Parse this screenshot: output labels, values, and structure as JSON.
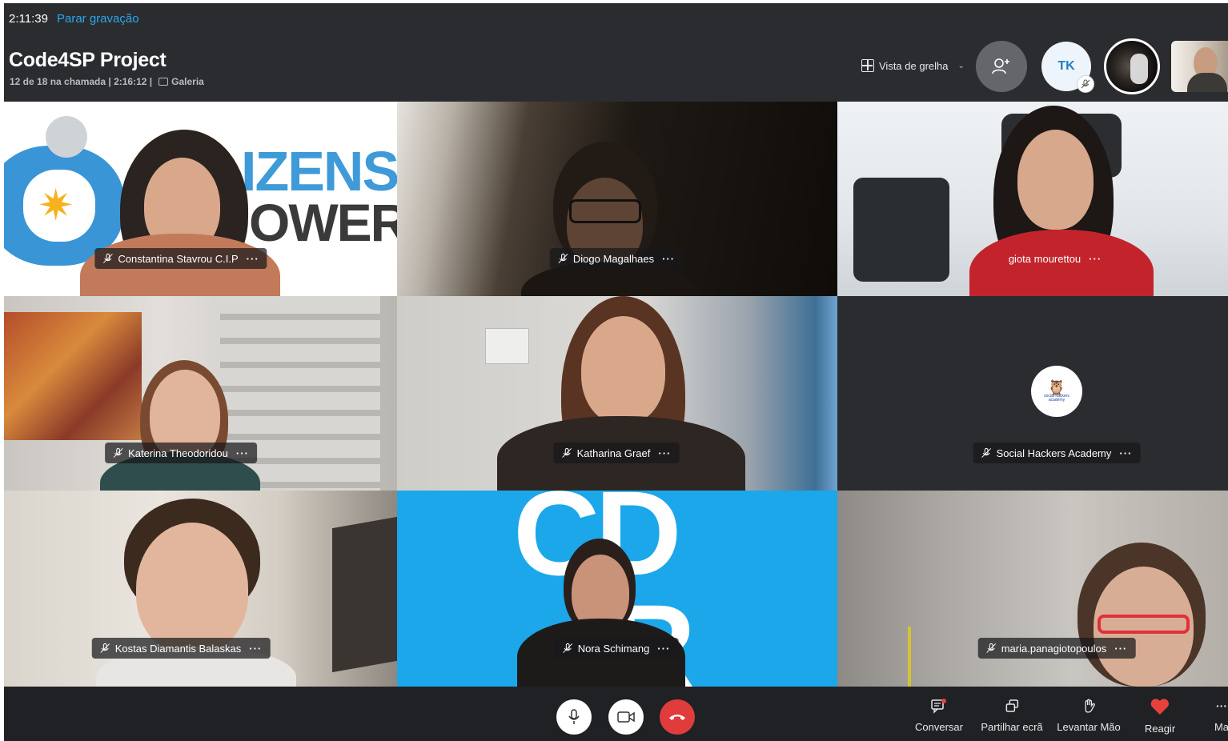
{
  "recording": {
    "elapsed": "2:11:39",
    "stop_label": "Parar gravação"
  },
  "call": {
    "title": "Code4SP Project",
    "participants_info": "12 de 18 na chamada | 2:16:12 |",
    "view_mode": "Galeria"
  },
  "header_controls": {
    "view_toggle_label": "Vista de grelha",
    "avatar_initials": "TK"
  },
  "participants": [
    {
      "name": "Constantina Stavrou C.I.P",
      "muted": true
    },
    {
      "name": "Diogo  Magalhaes",
      "muted": true
    },
    {
      "name": "giota mourettou",
      "muted": false
    },
    {
      "name": "Katerina Theodoridou",
      "muted": true
    },
    {
      "name": "Katharina Graef",
      "muted": true
    },
    {
      "name": "Social Hackers Academy",
      "muted": true
    },
    {
      "name": "Kostas Diamantis Balaskas",
      "muted": true
    },
    {
      "name": "Nora Schimang",
      "muted": true
    },
    {
      "name": "maria.panagiotopoulos",
      "muted": true
    }
  ],
  "tile_texts": {
    "citizens_top": "IZENS",
    "citizens_bottom": "OWER",
    "cdr_top": "CD",
    "cdr_bottom": "R",
    "sha_logo": "social hackers academy"
  },
  "actions": {
    "chat": "Conversar",
    "share": "Partilhar ecrã",
    "raise_hand": "Levantar Mão",
    "react": "Reagir",
    "more": "Ma"
  },
  "colors": {
    "accent_link": "#2aa8ea",
    "hangup": "#e03c3c",
    "react_heart": "#e8413c",
    "header_bg": "#2b2c30"
  }
}
